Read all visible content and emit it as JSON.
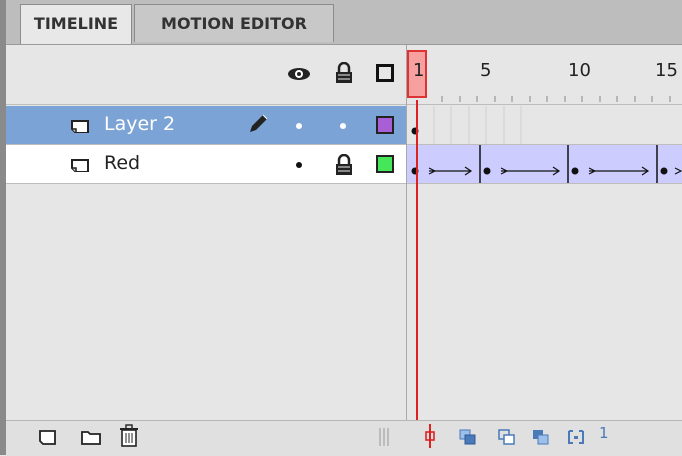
{
  "tabs": [
    {
      "label": "TIMELINE"
    },
    {
      "label": "MOTION EDITOR"
    }
  ],
  "header": {
    "eye_icon": "eye-icon",
    "lock_icon": "lock-icon",
    "outline_icon": "outline-square-icon"
  },
  "ruler": {
    "labels": [
      "1",
      "5",
      "10",
      "15"
    ],
    "current_frame": "1"
  },
  "layers": [
    {
      "name": "Layer 2",
      "selected": true,
      "color": "#a85fd6",
      "edit_icon": "pencil-icon"
    },
    {
      "name": "Red",
      "selected": false,
      "color": "#45e65a",
      "locked": true
    }
  ],
  "bottom_toolbar": {
    "left_icons": [
      "new-layer-icon",
      "new-folder-icon",
      "delete-icon"
    ],
    "right_icons": [
      "center-frame-icon",
      "onion-skin-icon",
      "onion-outline-icon",
      "edit-multiple-frames-icon",
      "modify-markers-icon",
      "current-frame-icon"
    ],
    "current_frame": "1"
  },
  "colors": {
    "selected_row": "#7ca3d6",
    "tween_fill": "#ccccff",
    "playhead": "#dd2222"
  }
}
